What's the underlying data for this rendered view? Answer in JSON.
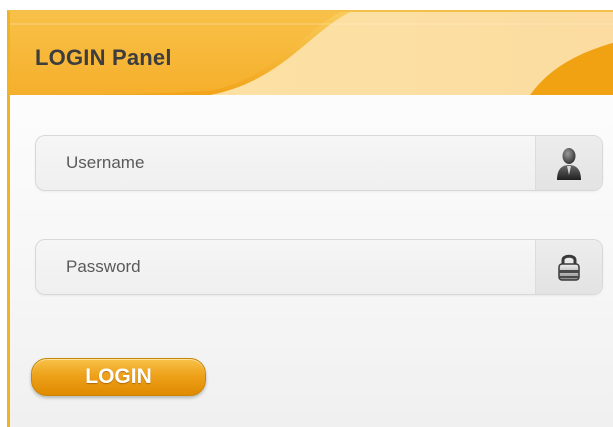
{
  "panel": {
    "title": "LOGIN Panel"
  },
  "form": {
    "username": {
      "placeholder": "Username",
      "value": "",
      "icon": "user-icon"
    },
    "password": {
      "placeholder": "Password",
      "value": "",
      "icon": "lock-icon"
    },
    "submit_label": "LOGIN"
  },
  "colors": {
    "accent": "#f0a81c",
    "accent_light": "#fde8b6",
    "text": "#3d3d3d"
  }
}
